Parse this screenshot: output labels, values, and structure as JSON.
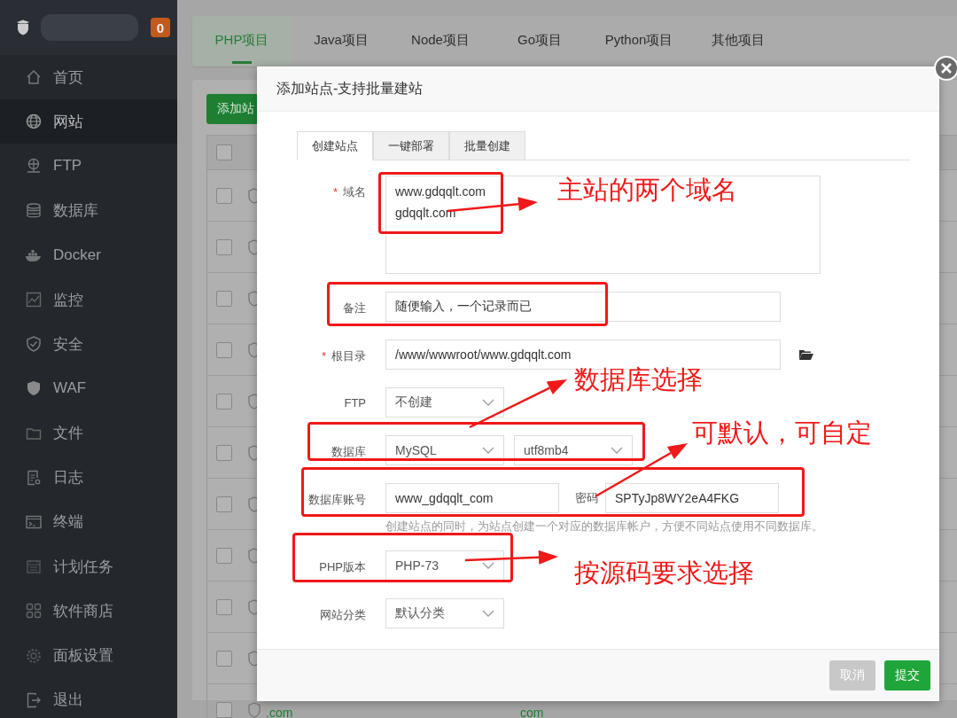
{
  "sidebar": {
    "badge": "0",
    "items": [
      {
        "label": "首页",
        "selected": false
      },
      {
        "label": "网站",
        "selected": true
      },
      {
        "label": "FTP",
        "selected": false
      },
      {
        "label": "数据库",
        "selected": false
      },
      {
        "label": "Docker",
        "selected": false
      },
      {
        "label": "监控",
        "selected": false
      },
      {
        "label": "安全",
        "selected": false
      },
      {
        "label": "WAF",
        "selected": false
      },
      {
        "label": "文件",
        "selected": false
      },
      {
        "label": "日志",
        "selected": false
      },
      {
        "label": "终端",
        "selected": false
      },
      {
        "label": "计划任务",
        "selected": false
      },
      {
        "label": "软件商店",
        "selected": false
      },
      {
        "label": "面板设置",
        "selected": false
      },
      {
        "label": "退出",
        "selected": false
      }
    ]
  },
  "project_tabs": [
    {
      "label": "PHP项目",
      "selected": true
    },
    {
      "label": "Java项目",
      "selected": false
    },
    {
      "label": "Node项目",
      "selected": false
    },
    {
      "label": "Go项目",
      "selected": false
    },
    {
      "label": "Python项目",
      "selected": false
    },
    {
      "label": "其他项目",
      "selected": false
    }
  ],
  "site_list": {
    "add_button": "添加站",
    "select_all_checked": false,
    "rows": [
      {
        "checked": false
      },
      {
        "checked": false
      },
      {
        "checked": false
      },
      {
        "checked": false
      },
      {
        "checked": false
      },
      {
        "checked": false
      },
      {
        "checked": false
      },
      {
        "checked": false
      },
      {
        "checked": false
      },
      {
        "checked": false
      },
      {
        "checked": false,
        "cells": [
          ".com",
          "com"
        ]
      }
    ]
  },
  "dialog": {
    "title": "添加站点-支持批量建站",
    "tabs": [
      {
        "label": "创建站点",
        "selected": true
      },
      {
        "label": "一键部署",
        "selected": false
      },
      {
        "label": "批量创建",
        "selected": false
      }
    ],
    "fields": [
      {
        "kind": "textarea",
        "marker": "*",
        "label": "域名",
        "lines": [
          "www.gdqqlt.com",
          "gdqqlt.com"
        ]
      },
      {
        "kind": "input",
        "label": "备注",
        "value": "随便输入，一个记录而已"
      },
      {
        "kind": "path",
        "marker": "*",
        "label": "根目录",
        "value": "/www/wwwroot/www.gdqqlt.com"
      },
      {
        "kind": "select",
        "label": "FTP",
        "options": [
          "不创建"
        ]
      },
      {
        "kind": "select",
        "label": "数据库",
        "options": [
          "MySQL",
          "utf8mb4"
        ]
      },
      {
        "kind": "pair",
        "label": "数据库账号",
        "value": "www_gdqqlt_com",
        "label2": "密码",
        "value2": "SPTyJp8WY2eA4FKG"
      },
      {
        "kind": "hint",
        "text": "创建站点的同时，为站点创建一个对应的数据库帐户，方便不同站点使用不同数据库。"
      },
      {
        "kind": "select",
        "label": "PHP版本",
        "options": [
          "PHP-73"
        ]
      },
      {
        "kind": "select",
        "label": "网站分类",
        "options": [
          "默认分类"
        ]
      }
    ],
    "buttons": [
      {
        "label": "取消",
        "kind": "cancel"
      },
      {
        "label": "提交",
        "kind": "submit"
      }
    ]
  },
  "annotations": [
    "主站的两个域名",
    "数据库选择",
    "可默认，可自定",
    "按源码要求选择"
  ]
}
